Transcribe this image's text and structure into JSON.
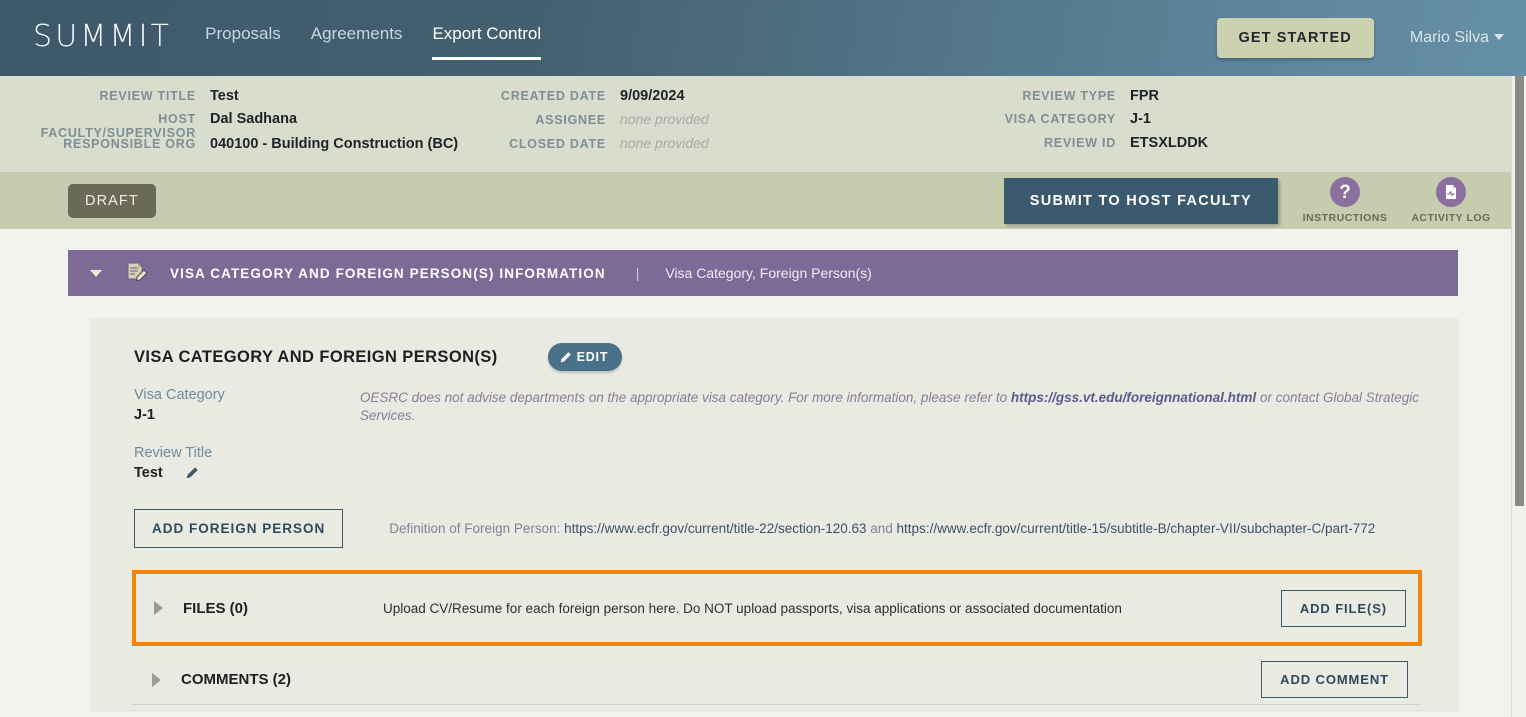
{
  "topnav": {
    "logo": "SUMMIT",
    "links": [
      {
        "label": "Proposals",
        "active": false
      },
      {
        "label": "Agreements",
        "active": false
      },
      {
        "label": "Export Control",
        "active": true
      }
    ],
    "get_started_label": "GET STARTED",
    "user_name": "Mario Silva",
    "accent_blue": "#3d586b",
    "accent_khaki": "#ccd1b0"
  },
  "infobar": {
    "col1": [
      {
        "label": "REVIEW TITLE",
        "value": "Test",
        "empty": false
      },
      {
        "label": "HOST FACULTY/SUPERVISOR",
        "value": "Dal Sadhana",
        "empty": false
      },
      {
        "label": "RESPONSIBLE ORG",
        "value": "040100 - Building Construction (BC)",
        "empty": false
      }
    ],
    "col2": [
      {
        "label": "CREATED DATE",
        "value": "9/09/2024",
        "empty": false
      },
      {
        "label": "ASSIGNEE",
        "value": "none provided",
        "empty": true
      },
      {
        "label": "CLOSED DATE",
        "value": "none provided",
        "empty": true
      }
    ],
    "col3": [
      {
        "label": "REVIEW TYPE",
        "value": "FPR",
        "empty": false
      },
      {
        "label": "VISA CATEGORY",
        "value": "J-1",
        "empty": false
      },
      {
        "label": "REVIEW ID",
        "value": "ETSXLDDK",
        "empty": false
      }
    ]
  },
  "actionbar": {
    "status_badge": "DRAFT",
    "submit_label": "SUBMIT TO HOST FACULTY",
    "instructions_label": "INSTRUCTIONS",
    "activity_log_label": "ACTIVITY LOG",
    "icon_color": "#8b6f9e"
  },
  "section": {
    "title": "VISA CATEGORY AND FOREIGN PERSON(S) INFORMATION",
    "separator": "|",
    "subtitle": "Visa Category, Foreign Person(s)",
    "bar_color": "#7d6a96"
  },
  "card": {
    "title": "VISA CATEGORY AND FOREIGN PERSON(S)",
    "edit_label": "EDIT",
    "visa_category_label": "Visa Category",
    "visa_category_value": "J-1",
    "review_title_label": "Review Title",
    "review_title_value": "Test",
    "note_prefix": "OESRC does not advise departments on the appropriate visa category. For more information, please refer to ",
    "note_link": "https://gss.vt.edu/foreignnational.html",
    "note_suffix": " or contact Global Strategic Services.",
    "add_foreign_person_label": "ADD FOREIGN PERSON",
    "definition_prefix": "Definition of Foreign Person: ",
    "definition_link1": "https://www.ecfr.gov/current/title-22/section-120.63",
    "definition_joiner": " and ",
    "definition_link2": "https://www.ecfr.gov/current/title-15/subtitle-B/chapter-VII/subchapter-C/part-772"
  },
  "accordions": {
    "files": {
      "label": "FILES (0)",
      "description": "Upload CV/Resume for each foreign person here. Do NOT upload passports, visa applications or associated documentation",
      "button_label": "ADD FILE(S)",
      "highlight_color": "#f2840a"
    },
    "comments": {
      "label": "COMMENTS (2)",
      "description": "",
      "button_label": "ADD COMMENT"
    }
  }
}
